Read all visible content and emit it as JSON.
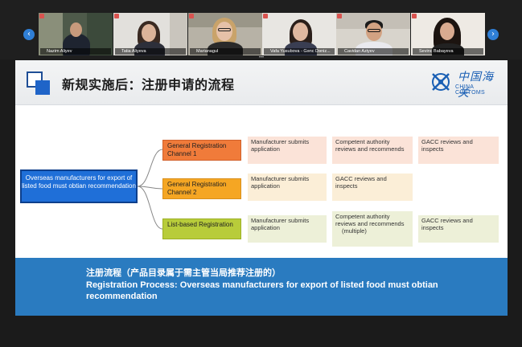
{
  "participants": [
    {
      "name": "Nazim Aliyev"
    },
    {
      "name": "Tatia Aliyeva"
    },
    {
      "name": "Marianagul"
    },
    {
      "name": "Vafa Yusubova - Gənc Dəniz..."
    },
    {
      "name": "Cavidan Aziyev"
    },
    {
      "name": "Sevinc Babayeva"
    }
  ],
  "strip": {
    "prev_icon": "‹",
    "next_icon": "›",
    "more_dots": "•••"
  },
  "slide": {
    "title": "新规实施后：注册申请的流程",
    "logo_cn": "中国海关",
    "logo_en": "CHINA CUSTOMS",
    "source_box": "Overseas manufacturers for export of listed food must obtian recommendation",
    "channels": [
      {
        "label": "General Registration Channel 1",
        "color": "#f07b3a"
      },
      {
        "label": "General Registration Channel 2",
        "color": "#f5a623"
      },
      {
        "label": "List-based Registration",
        "color": "#b8cc3a"
      }
    ],
    "steps": {
      "c1_s1": "Manufacturer submits application",
      "c1_s2": "Competent authority reviews and recommends",
      "c1_s3": "GACC reviews and inspects",
      "c2_s1": "Manufacturer submits application",
      "c2_s2": "GACC reviews and inspects",
      "c3_s1": "Manufacturer submits application",
      "c3_s2": "Competent authority reviews and recommends",
      "c3_s2_note": "(multiple)",
      "c3_s3": "GACC reviews and inspects"
    },
    "footer_cn": "注册流程（产品目录属于需主管当局推荐注册的）",
    "footer_en": "Registration Process: Overseas manufacturers for export of listed food must obtian recommendation"
  },
  "colors": {
    "footer_bar": "#2a7bc0",
    "source_box": "#1f6fd8",
    "title_accent": "#1f64c8"
  }
}
